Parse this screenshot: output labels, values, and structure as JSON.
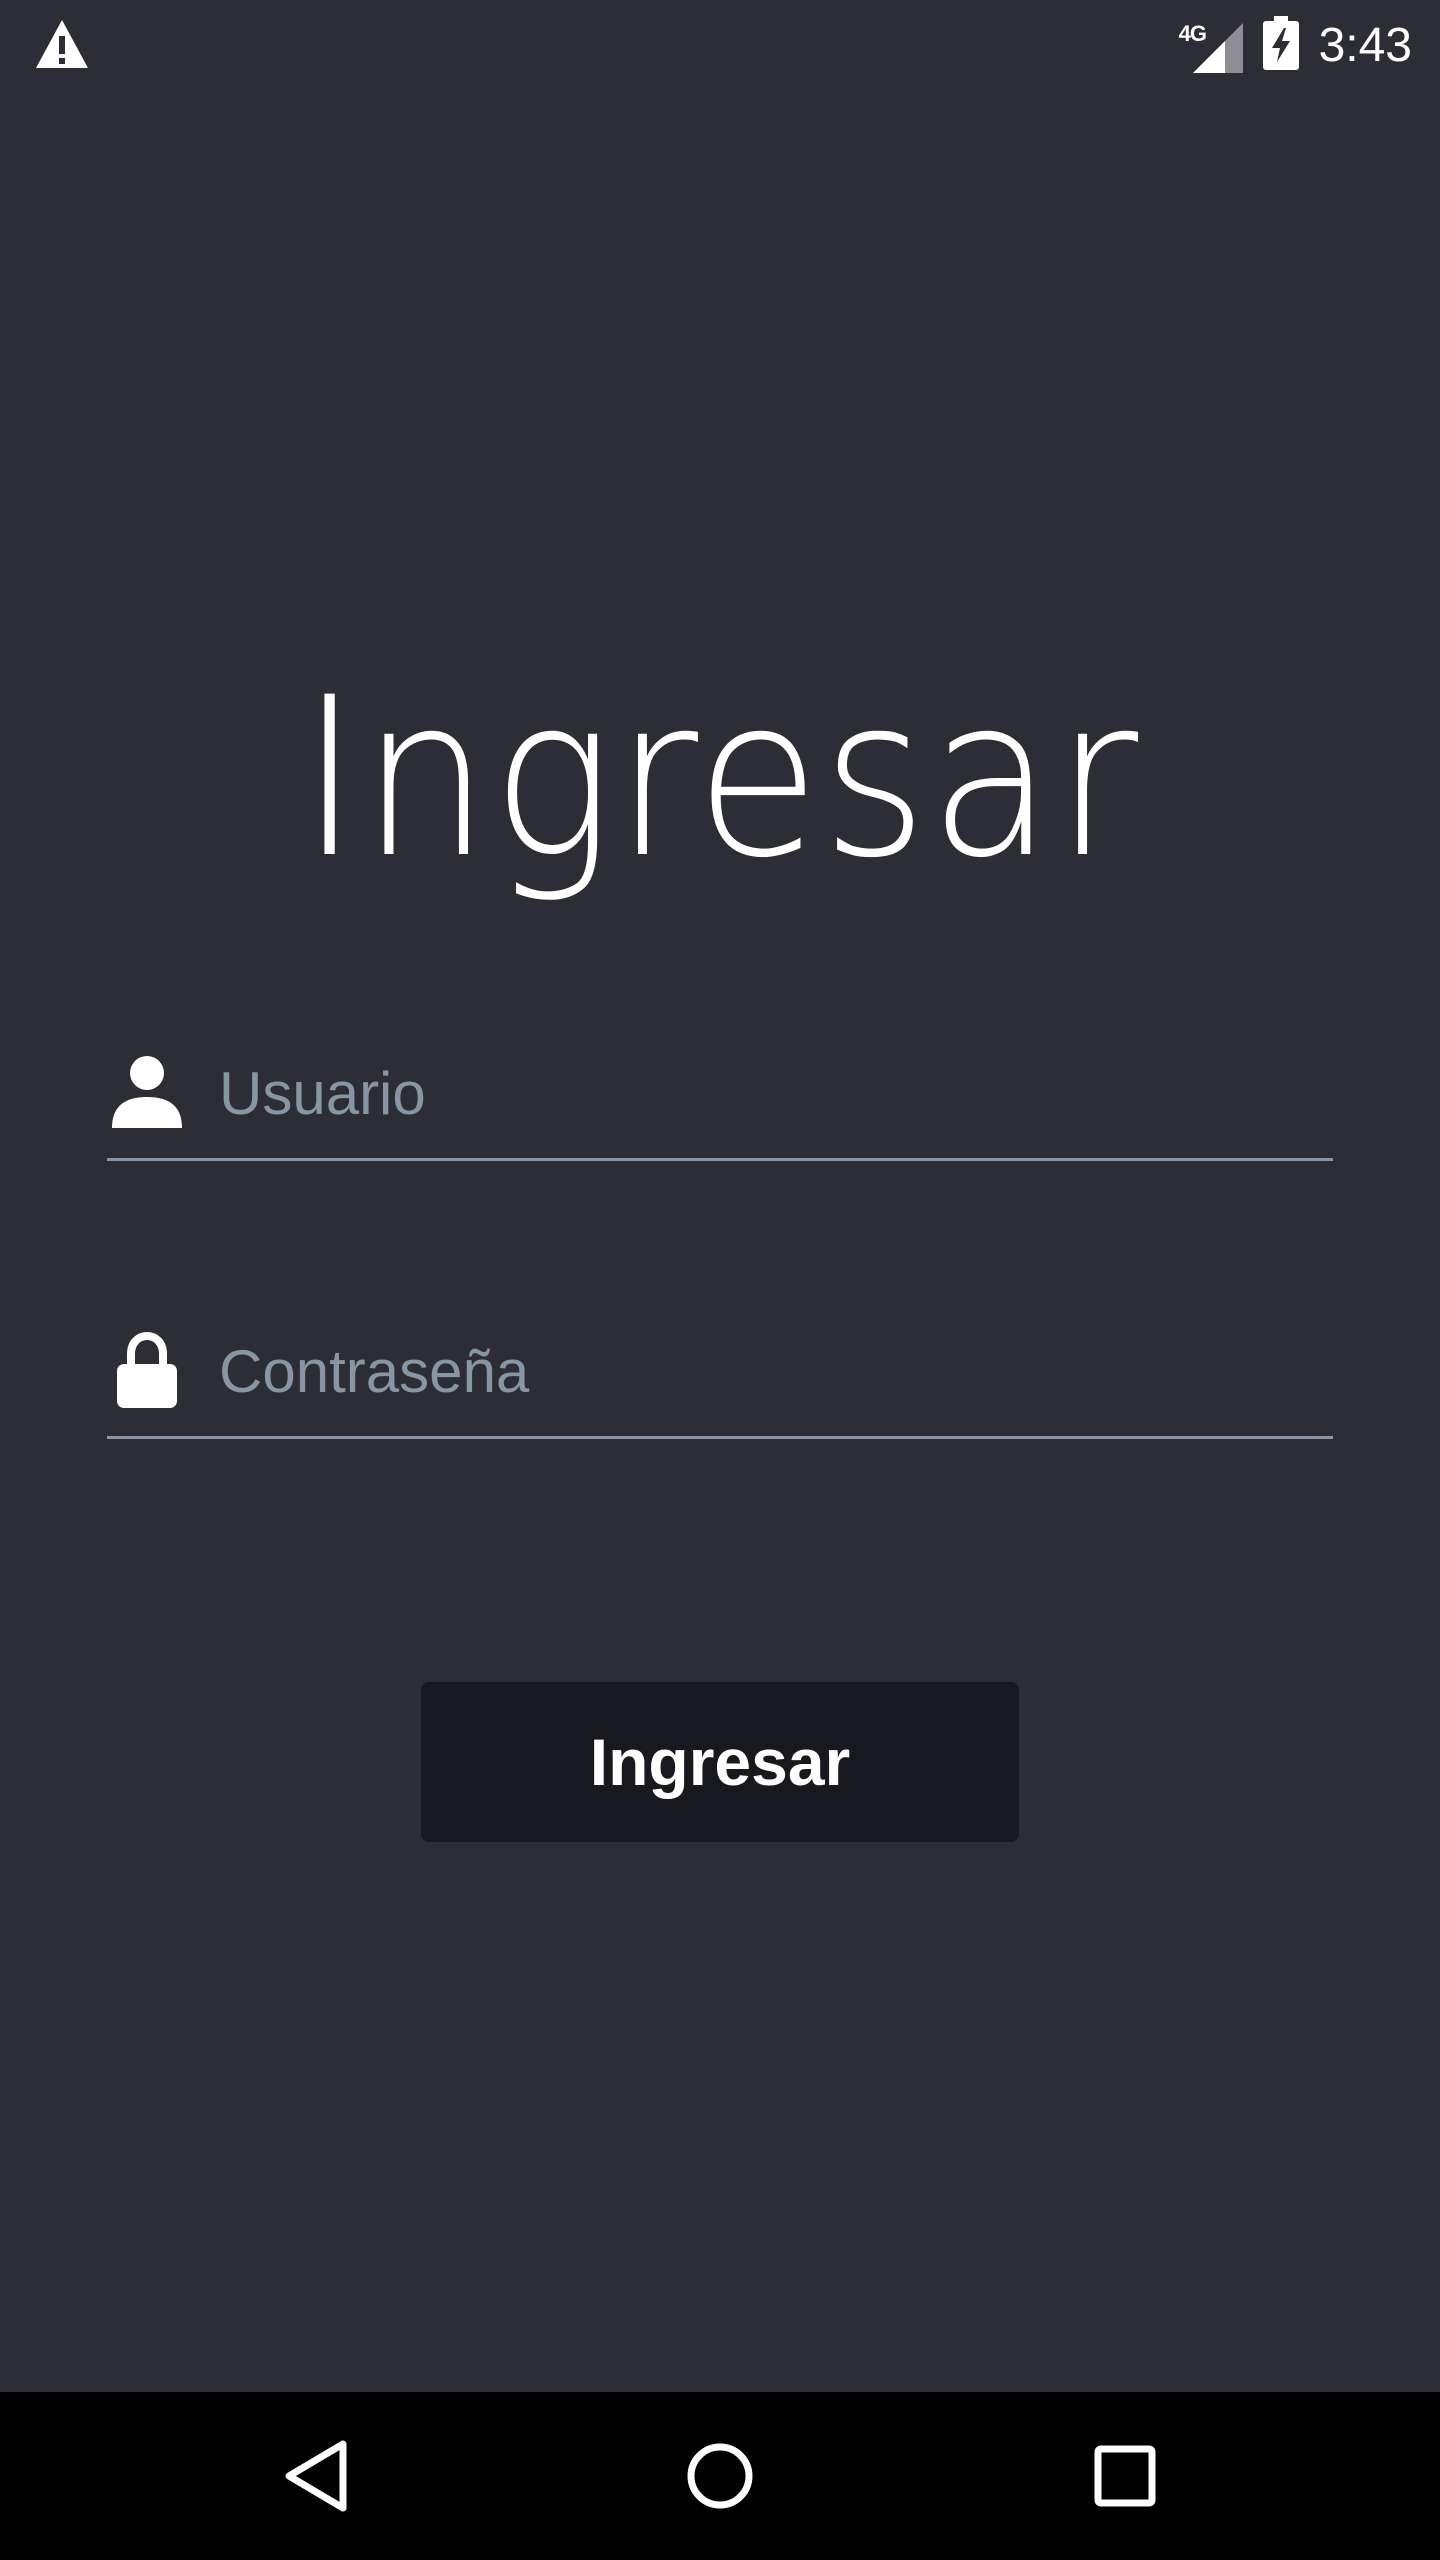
{
  "status_bar": {
    "alert_icon": "warning-triangle-icon",
    "network_label": "4G",
    "signal_icon": "cell-signal-icon",
    "battery_icon": "battery-charging-icon",
    "time": "3:43"
  },
  "login": {
    "title": "Ingresar",
    "username": {
      "icon": "person-icon",
      "placeholder": "Usuario",
      "value": ""
    },
    "password": {
      "icon": "lock-icon",
      "placeholder": "Contraseña",
      "value": ""
    },
    "submit_label": "Ingresar"
  },
  "nav_bar": {
    "back_icon": "back-triangle-icon",
    "home_icon": "home-circle-icon",
    "recents_icon": "recents-square-icon"
  },
  "colors": {
    "background": "#2d2d35",
    "button": "#18181f",
    "underline": "#8a96a3",
    "placeholder": "#8895a3",
    "text": "#ffffff"
  }
}
